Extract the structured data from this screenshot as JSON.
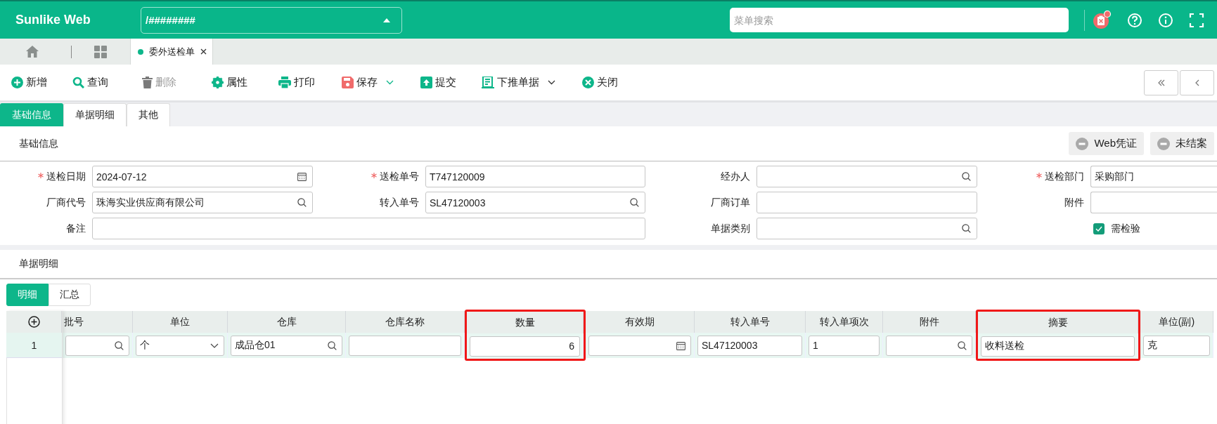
{
  "app": {
    "name": "Sunlike Web",
    "path": "/########",
    "search_placeholder": "菜单搜索"
  },
  "tabs": [
    {
      "label": "委外送检单",
      "selected": true
    }
  ],
  "toolbar": [
    {
      "kind": "add",
      "label": "新增",
      "disabled": false,
      "menu": false
    },
    {
      "kind": "search",
      "label": "查询",
      "disabled": false,
      "menu": false
    },
    {
      "kind": "delete",
      "label": "删除",
      "disabled": true,
      "menu": false
    },
    {
      "kind": "gear",
      "label": "属性",
      "disabled": false,
      "menu": false
    },
    {
      "kind": "print",
      "label": "打印",
      "disabled": false,
      "menu": false
    },
    {
      "kind": "save",
      "label": "保存",
      "disabled": false,
      "menu": true
    },
    {
      "kind": "submit",
      "label": "提交",
      "disabled": false,
      "menu": false
    },
    {
      "kind": "push",
      "label": "下推单据",
      "disabled": false,
      "menu": true
    },
    {
      "kind": "close",
      "label": "关闭",
      "disabled": false,
      "menu": false
    }
  ],
  "form_tabs": [
    {
      "label": "基础信息",
      "selected": true
    },
    {
      "label": "单据明细",
      "selected": false
    },
    {
      "label": "其他",
      "selected": false
    }
  ],
  "basic_section": {
    "title": "基础信息",
    "actions": [
      "Web凭证",
      "未结案"
    ]
  },
  "fields": [
    {
      "kind": "date",
      "label": "送检日期",
      "required": true,
      "value": "2024-07-12"
    },
    {
      "kind": "text",
      "label": "送检单号",
      "required": true,
      "value": "T747120009"
    },
    {
      "kind": "search",
      "label": "经办人",
      "required": false
    },
    {
      "kind": "text",
      "label": "送检部门",
      "required": true,
      "value": "采购部门"
    },
    {
      "kind": "search",
      "label": "厂商代号",
      "required": false,
      "value": "珠海实业供应商有限公司"
    },
    {
      "kind": "search",
      "label": "转入单号",
      "required": false,
      "value": "SL47120003"
    },
    {
      "kind": "text",
      "label": "厂商订单",
      "required": false
    },
    {
      "kind": "text",
      "label": "附件",
      "required": false
    },
    {
      "kind": "wide",
      "label": "备注",
      "required": false
    },
    {
      "kind": "search",
      "label": "单据类别",
      "required": false
    },
    {
      "kind": "checkbox",
      "label": "需检验",
      "checked": true
    }
  ],
  "detail_section": {
    "title": "单据明细"
  },
  "detail_tabs": [
    {
      "label": "明细",
      "selected": true
    },
    {
      "label": "汇总",
      "selected": false
    }
  ],
  "table": {
    "columns": [
      {
        "label": "批号",
        "clipped": true,
        "highlighted": false
      },
      {
        "label": "单位",
        "clipped": false,
        "highlighted": false
      },
      {
        "label": "仓库",
        "clipped": false,
        "highlighted": false
      },
      {
        "label": "仓库名称",
        "clipped": false,
        "highlighted": false
      },
      {
        "label": "数量",
        "clipped": false,
        "highlighted": true
      },
      {
        "label": "有效期",
        "clipped": false,
        "highlighted": false
      },
      {
        "label": "转入单号",
        "clipped": false,
        "highlighted": false
      },
      {
        "label": "转入单项次",
        "clipped": false,
        "highlighted": false
      },
      {
        "label": "附件",
        "clipped": false,
        "highlighted": false
      },
      {
        "label": "摘要",
        "clipped": false,
        "highlighted": true
      },
      {
        "label": "单位(副)",
        "clipped": false,
        "highlighted": false
      }
    ],
    "rows": [
      {
        "index": "1",
        "cells": [
          {
            "kind": "search"
          },
          {
            "kind": "select",
            "value": "个"
          },
          {
            "kind": "search",
            "value": "成品仓01"
          },
          {
            "kind": "text"
          },
          {
            "kind": "number",
            "value": "6"
          },
          {
            "kind": "date"
          },
          {
            "kind": "text",
            "value": "SL47120003"
          },
          {
            "kind": "text",
            "value": "1"
          },
          {
            "kind": "search"
          },
          {
            "kind": "text",
            "value": "收料送检"
          },
          {
            "kind": "text",
            "value": "克"
          }
        ]
      }
    ]
  }
}
